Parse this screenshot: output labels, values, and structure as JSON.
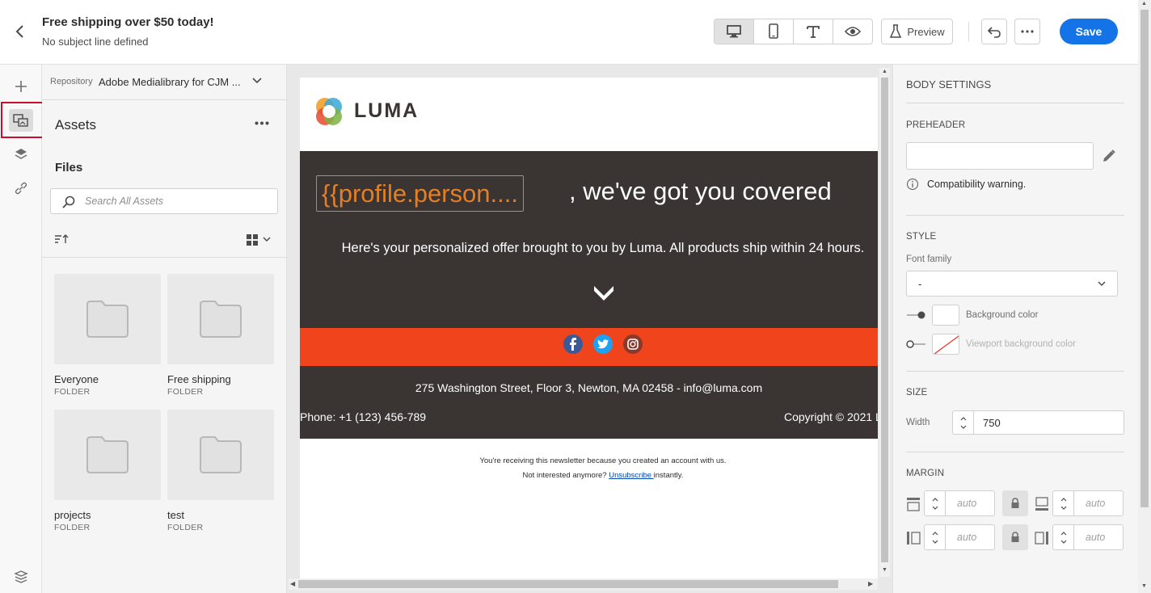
{
  "header": {
    "title": "Free shipping over $50 today!",
    "subtitle": "No subject line defined",
    "preview_label": "Preview",
    "save_label": "Save"
  },
  "assets": {
    "repository_label": "Repository",
    "repository_value": "Adobe Medialibrary for CJM ...",
    "title": "Assets",
    "files_label": "Files",
    "search_placeholder": "Search All Assets",
    "folders": [
      {
        "name": "Everyone",
        "type": "FOLDER"
      },
      {
        "name": "Free shipping",
        "type": "FOLDER"
      },
      {
        "name": "projects",
        "type": "FOLDER"
      },
      {
        "name": "test",
        "type": "FOLDER"
      }
    ]
  },
  "email": {
    "brand": "LUMA",
    "headline_token": "{{profile.person....",
    "headline_rest": ", we've got you covered",
    "offer_text": "Here's your personalized offer brought to you by Luma. All products ship within 24 hours.",
    "address": "275 Washington Street, Floor 3, Newton, MA 02458 - info@luma.com",
    "phone": "Phone: +1 (123) 456-789",
    "copyright": "Copyright © 2021 L",
    "footer_line1": "You're receiving this newsletter because you created an account with us.",
    "footer_line2_pre": "Not interested anymore?",
    "footer_link": "Unsubscribe ",
    "footer_line2_post": "instantly.",
    "colors": {
      "dark": "#3a3433",
      "orange": "#f0441c",
      "token": "#e37f26"
    }
  },
  "settings": {
    "body_settings": "BODY SETTINGS",
    "preheader": "PREHEADER",
    "compat_warning": "Compatibility warning.",
    "style": "STYLE",
    "font_family_label": "Font family",
    "font_family_value": "-",
    "background_color_label": "Background color",
    "viewport_bg_label": "Viewport background color",
    "size": "SIZE",
    "width_label": "Width",
    "width_value": "750",
    "margin": "MARGIN",
    "margin_placeholder": "auto"
  },
  "colors": {
    "accent": "#1473e6",
    "highlight_border": "#c8102e"
  }
}
